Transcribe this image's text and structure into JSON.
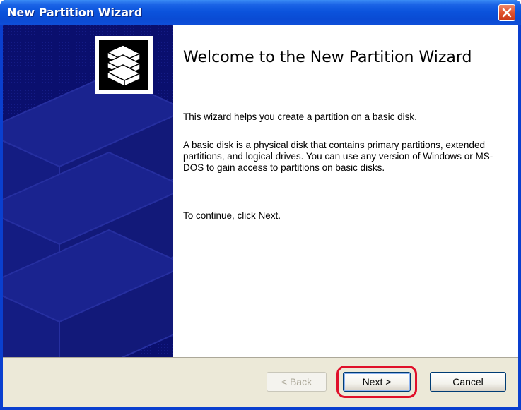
{
  "window": {
    "title": "New Partition Wizard"
  },
  "icons": {
    "close": "close-icon",
    "wizard": "disk-stack-icon"
  },
  "content": {
    "heading": "Welcome to the New Partition Wizard",
    "paragraph1": "This wizard helps you create a partition on a basic disk.",
    "paragraph2": "A basic disk is a physical disk that contains primary partitions, extended partitions, and logical drives. You can use any version of Windows or MS-DOS to gain access to partitions on basic disks.",
    "paragraph3": "To continue, click Next."
  },
  "buttons": {
    "back_label": "< Back",
    "next_label": "Next >",
    "cancel_label": "Cancel"
  },
  "colors": {
    "titlebar": "#0b53dc",
    "sidebar": "#0a0f6e",
    "highlight": "#e0102a",
    "dialog_face": "#ece9d8"
  }
}
